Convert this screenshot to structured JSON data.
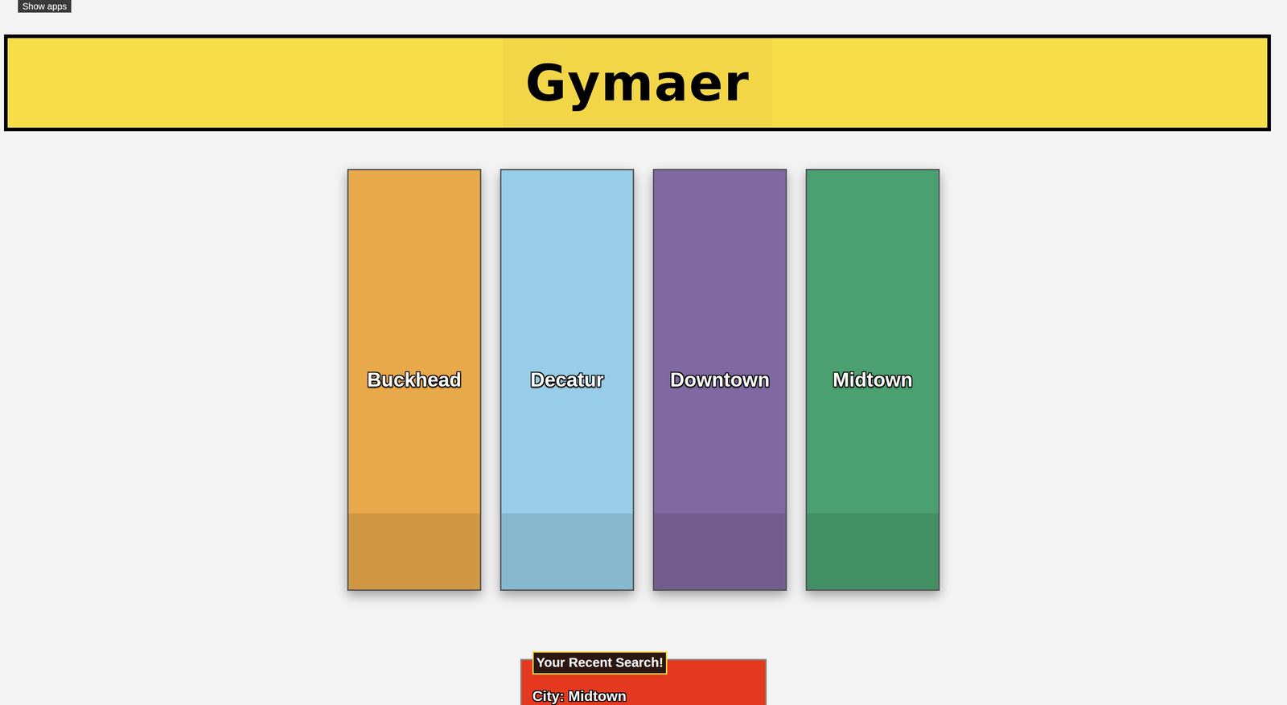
{
  "tooltip": "Show apps",
  "header": {
    "brand": "Gymaer"
  },
  "cities": [
    {
      "name": "Buckhead",
      "color": "#e8a94a"
    },
    {
      "name": "Decatur",
      "color": "#97cde6"
    },
    {
      "name": "Downtown",
      "color": "#8068a0"
    },
    {
      "name": "Midtown",
      "color": "#4aa070"
    }
  ],
  "recent": {
    "label": "Your Recent Search!",
    "text": "City: Midtown"
  }
}
